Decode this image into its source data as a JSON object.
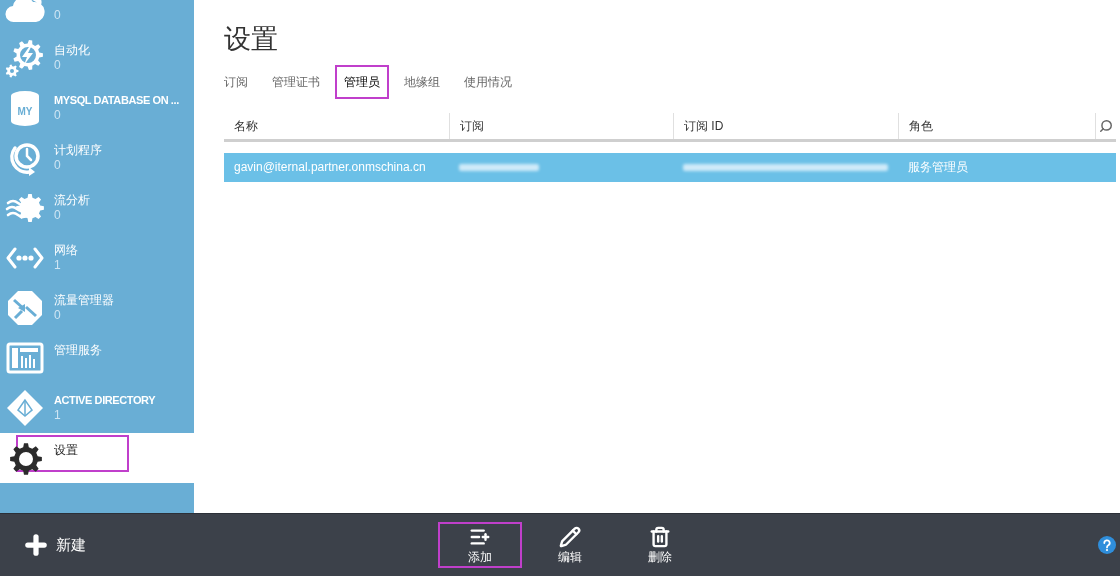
{
  "sidebar": {
    "items": [
      {
        "count": "0",
        "selected": false,
        "highlighted": false
      },
      {
        "label": "自动化",
        "count": "0",
        "selected": false,
        "highlighted": false
      },
      {
        "label": "MYSQL DATABASE ON ...",
        "icon_label": "MY",
        "count": "0",
        "selected": false,
        "highlighted": false
      },
      {
        "label": "计划程序",
        "count": "0",
        "selected": false,
        "highlighted": false
      },
      {
        "label": "流分析",
        "count": "0",
        "selected": false,
        "highlighted": false
      },
      {
        "label": "网络",
        "count": "1",
        "selected": false,
        "highlighted": false
      },
      {
        "label": "流量管理器",
        "count": "0",
        "selected": false,
        "highlighted": false
      },
      {
        "label": "管理服务",
        "selected": false,
        "highlighted": false
      },
      {
        "label": "ACTIVE DIRECTORY",
        "count": "1",
        "selected": false,
        "highlighted": false
      },
      {
        "label": "设置",
        "selected": true,
        "highlighted": true
      }
    ]
  },
  "page": {
    "title": "设置",
    "tabs": [
      {
        "label": "订阅",
        "selected": false,
        "highlighted": false
      },
      {
        "label": "管理证书",
        "selected": false,
        "highlighted": false
      },
      {
        "label": "管理员",
        "selected": true,
        "highlighted": true
      },
      {
        "label": "地缘组",
        "selected": false,
        "highlighted": false
      },
      {
        "label": "使用情况",
        "selected": false,
        "highlighted": false
      }
    ],
    "table": {
      "columns": [
        "名称",
        "订阅",
        "订阅 ID",
        "角色"
      ],
      "rows": [
        {
          "selected": true,
          "cells": [
            {
              "text": "gavin@iternal.partner.onmschina.cn"
            },
            {
              "redacted": true
            },
            {
              "redacted": true
            },
            {
              "text": "服务管理员"
            }
          ]
        }
      ]
    }
  },
  "command_bar": {
    "new_button": {
      "label": "新建"
    },
    "actions": [
      {
        "label": "添加",
        "highlighted": true
      },
      {
        "label": "编辑",
        "highlighted": false
      },
      {
        "label": "删除",
        "highlighted": false
      }
    ]
  }
}
